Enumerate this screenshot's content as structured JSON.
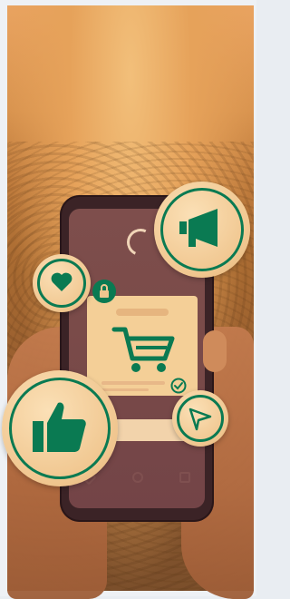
{
  "scene": {
    "subject": "hands-holding-smartphone",
    "phone_screen": {
      "screen_icon": "shopping-cart-icon",
      "status_icon": "check-icon"
    },
    "floating_icons": [
      "megaphone-icon",
      "heart-icon",
      "lock-icon",
      "thumbs-up-icon",
      "send-icon"
    ],
    "colors": {
      "overlay_orange": "#d9944f",
      "icon_green": "#0a7a52",
      "bubble_cream": "#f0c68f",
      "phone_dark": "#3b2326"
    }
  }
}
